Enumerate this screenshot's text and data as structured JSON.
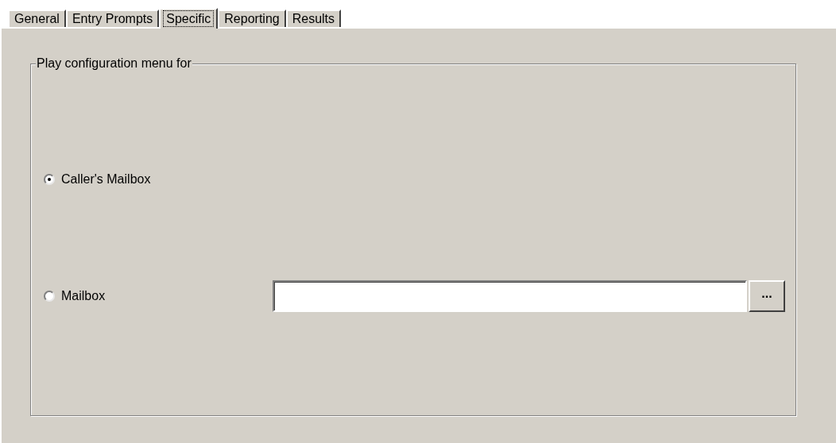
{
  "tabs": [
    {
      "label": "General",
      "selected": false
    },
    {
      "label": "Entry Prompts",
      "selected": false
    },
    {
      "label": "Specific",
      "selected": true
    },
    {
      "label": "Reporting",
      "selected": false
    },
    {
      "label": "Results",
      "selected": false
    }
  ],
  "group": {
    "title": "Play configuration menu for",
    "options": [
      {
        "label": "Caller's Mailbox",
        "selected": true,
        "kind": "radio"
      },
      {
        "label": "Mailbox",
        "selected": false,
        "kind": "radio-field",
        "browse": "..."
      }
    ]
  }
}
